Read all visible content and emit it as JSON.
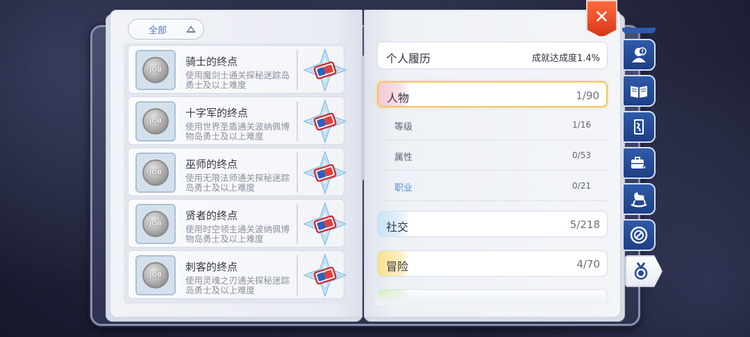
{
  "filter": {
    "label": "全部"
  },
  "achievements": [
    {
      "title": "骑士的终点",
      "desc": "使用魔剑士通关探秘迷踪岛勇士及以上难度",
      "badge": "JOB"
    },
    {
      "title": "十字军的终点",
      "desc": "使用世界圣盾通关波纳佩博物岛勇士及以上难度",
      "badge": "JOB"
    },
    {
      "title": "巫师的终点",
      "desc": "使用无限法师通关探秘迷踪岛勇士及以上难度",
      "badge": "JOB"
    },
    {
      "title": "贤者的终点",
      "desc": "使用时空领主通关波纳佩博物岛勇士及以上难度",
      "badge": "JOB"
    },
    {
      "title": "刺客的终点",
      "desc": "使用灵魂之刃通关探秘迷踪岛勇士及以上难度",
      "badge": "JOB"
    }
  ],
  "resume": {
    "title": "个人履历",
    "rate": "成就达成度1.4%"
  },
  "categories": [
    {
      "label": "人物",
      "count": "1/90",
      "color": "#f6c7d2",
      "selected": true
    },
    {
      "label": "社交",
      "count": "5/218",
      "color": "#c9e3f7"
    },
    {
      "label": "冒险",
      "count": "4/70",
      "color": "#f9e08f"
    }
  ],
  "subcategories": [
    {
      "label": "等级",
      "count": "1/16"
    },
    {
      "label": "属性",
      "count": "0/53"
    },
    {
      "label": "职业",
      "count": "0/21",
      "active": true
    }
  ],
  "close": {
    "label": "✕"
  },
  "tabs": [
    {
      "icon": "profile-icon"
    },
    {
      "icon": "book-icon"
    },
    {
      "icon": "card-icon"
    },
    {
      "icon": "briefcase-heart-icon"
    },
    {
      "icon": "rocking-horse-icon"
    },
    {
      "icon": "compass-icon"
    },
    {
      "icon": "medal-icon",
      "active": true
    }
  ],
  "colors": {
    "accent": "#4f8ad0",
    "close": "#e5482a",
    "tab": "#264c98"
  }
}
